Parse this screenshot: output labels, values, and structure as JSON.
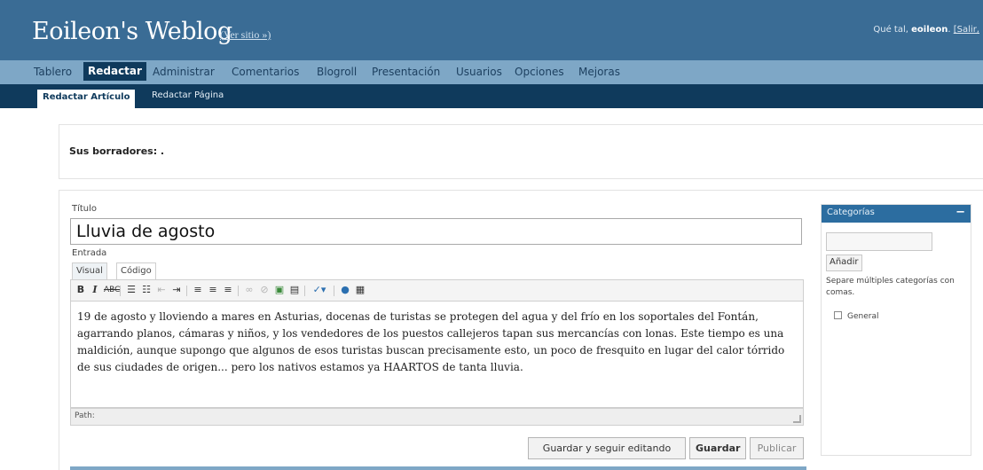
{
  "header": {
    "blog_title": "Eoileon's Weblog",
    "view_site": "(Ver sitio »)",
    "greeting_prefix": "Qué tal,",
    "username": "eoileon",
    "logout": "[Salir,"
  },
  "main_nav": {
    "items": [
      "Tablero",
      "Redactar",
      "Administrar",
      "Comentarios",
      "Blogroll",
      "Presentación",
      "Usuarios",
      "Opciones",
      "Mejoras"
    ],
    "active": "Redactar"
  },
  "sub_nav": {
    "items": [
      "Redactar Artículo",
      "Redactar Página"
    ],
    "active": "Redactar Artículo"
  },
  "drafts": {
    "label": "Sus borradores: ."
  },
  "post": {
    "title_label": "Título",
    "title_value": "Lluvia de agosto",
    "entry_label": "Entrada",
    "tabs": [
      "Visual",
      "Código"
    ],
    "toolbar_icons": [
      "bold-icon",
      "italic-icon",
      "strikethrough-icon",
      "unordered-list-icon",
      "ordered-list-icon",
      "outdent-icon",
      "indent-icon",
      "align-left-icon",
      "align-center-icon",
      "align-right-icon",
      "link-icon",
      "unlink-icon",
      "image-icon",
      "more-icon",
      "spellcheck-icon",
      "help-icon",
      "toolbar-toggle-icon"
    ],
    "body": "19 de agosto y lloviendo a mares en Asturias, docenas de turistas se protegen del agua y del frío en los soportales del Fontán, agarrando planos, cámaras y niños, y los vendedores de los puestos callejeros tapan sus mercancías con lonas. Este tiempo es una maldición, aunque supongo que algunos de esos turistas buscan precisamente esto, un poco de fresquito en lugar del calor tórrido de sus ciudades de origen... pero los nativos estamos ya HAARTOS de tanta lluvia.",
    "path_label": "Path:",
    "buttons": {
      "save_continue": "Guardar y seguir editando",
      "save": "Guardar",
      "publish": "Publicar"
    }
  },
  "categories": {
    "header": "Categorías",
    "collapse": "−",
    "new_category_value": "",
    "add_button": "Añadir",
    "help_text": "Separe múltiples categorías con comas.",
    "items": [
      {
        "label": "General",
        "checked": false
      }
    ]
  },
  "colors": {
    "header_bg": "#3a6c95",
    "nav_bg": "#7ea7c6",
    "subnav_bg": "#0f3a5c",
    "category_header_bg": "#2c6da0"
  }
}
